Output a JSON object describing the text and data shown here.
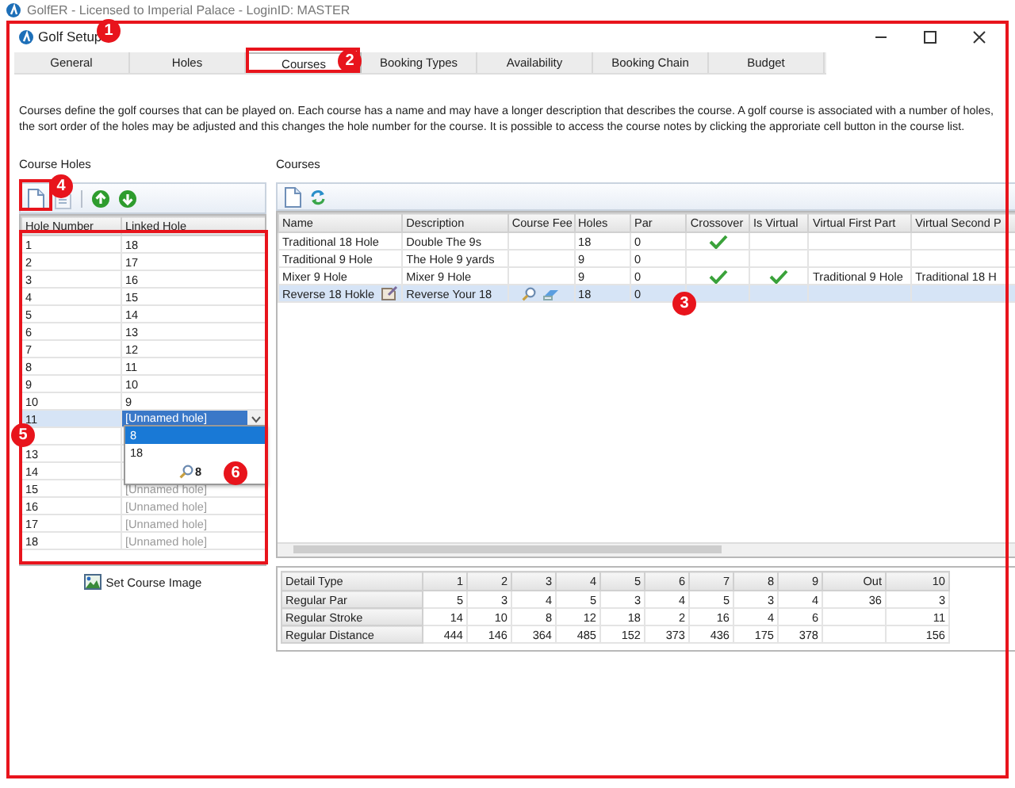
{
  "app_window": {
    "title": "GolfER - Licensed to Imperial Palace - LoginID: MASTER"
  },
  "dialog": {
    "title": "Golf Setup"
  },
  "tabs": [
    {
      "label": "General",
      "selected": false
    },
    {
      "label": "Holes",
      "selected": false
    },
    {
      "label": "Courses",
      "selected": true
    },
    {
      "label": "Booking Types",
      "selected": false
    },
    {
      "label": "Availability",
      "selected": false
    },
    {
      "label": "Booking Chain",
      "selected": false
    },
    {
      "label": "Budget",
      "selected": false
    }
  ],
  "description": "Courses define the golf courses that can be played on. Each course has a name and may have a longer description that describes the course. A golf course is associated with a number of holes, the sort order of the holes may be adjusted and this changes the hole number for the course. It is possible to access the course notes by clicking the approriate cell button in the course list.",
  "course_holes": {
    "title": "Course Holes",
    "columns": [
      "Hole Number",
      "Linked Hole"
    ],
    "rows": [
      {
        "hole": "1",
        "linked": "18",
        "kind": "linked",
        "selected": false
      },
      {
        "hole": "2",
        "linked": "17",
        "kind": "linked",
        "selected": false
      },
      {
        "hole": "3",
        "linked": "16",
        "kind": "linked",
        "selected": false
      },
      {
        "hole": "4",
        "linked": "15",
        "kind": "linked",
        "selected": false
      },
      {
        "hole": "5",
        "linked": "14",
        "kind": "linked",
        "selected": false
      },
      {
        "hole": "6",
        "linked": "13",
        "kind": "linked",
        "selected": false
      },
      {
        "hole": "7",
        "linked": "12",
        "kind": "linked",
        "selected": false
      },
      {
        "hole": "8",
        "linked": "11",
        "kind": "linked",
        "selected": false
      },
      {
        "hole": "9",
        "linked": "10",
        "kind": "linked",
        "selected": false
      },
      {
        "hole": "10",
        "linked": "9",
        "kind": "linked",
        "selected": false
      },
      {
        "hole": "11",
        "linked": "[Unnamed hole]",
        "kind": "editing",
        "selected": true
      },
      {
        "kind": "linked",
        "selected": false
      },
      {
        "hole": "13",
        "kind": "linked",
        "selected": false
      },
      {
        "hole": "14",
        "kind": "linked",
        "selected": false
      },
      {
        "hole": "15",
        "linked": "[Unnamed hole]",
        "kind": "unassigned",
        "selected": false
      },
      {
        "hole": "16",
        "linked": "[Unnamed hole]",
        "kind": "unassigned",
        "selected": false
      },
      {
        "hole": "17",
        "linked": "[Unnamed hole]",
        "kind": "unassigned",
        "selected": false
      },
      {
        "hole": "18",
        "linked": "[Unnamed hole]",
        "kind": "unassigned",
        "selected": false
      }
    ],
    "dropdown": {
      "options": [
        {
          "label": "8",
          "selected": true
        },
        {
          "label": "18",
          "selected": false
        }
      ],
      "search": "8"
    },
    "set_image_label": "Set Course Image"
  },
  "courses": {
    "title": "Courses",
    "columns": [
      "Name",
      "Description",
      "Course Fee",
      "Holes",
      "Par",
      "Crossover",
      "Is Virtual",
      "Virtual First Part",
      "Virtual Second P"
    ],
    "rows": [
      {
        "name": "Traditional 18 Hole",
        "description": "Double The 9s",
        "holes": "18",
        "par": "0",
        "crossover": true,
        "is_virtual": false,
        "selected": false
      },
      {
        "name": "Traditional 9 Hole",
        "description": "The Hole 9 yards",
        "holes": "9",
        "par": "0",
        "crossover": false,
        "is_virtual": false,
        "selected": false
      },
      {
        "name": "Mixer 9 Hole",
        "description": "Mixer 9 Hole",
        "holes": "9",
        "par": "0",
        "crossover": true,
        "is_virtual": true,
        "virtual_first": "Traditional 9 Hole",
        "virtual_second": "Traditional 18 H",
        "selected": false
      },
      {
        "name": "Reverse 18 Hokle",
        "description": "Reverse Your 18",
        "holes": "18",
        "par": "0",
        "crossover": false,
        "is_virtual": false,
        "selected": true
      }
    ]
  },
  "details": {
    "columns": [
      "Detail Type",
      "1",
      "2",
      "3",
      "4",
      "5",
      "6",
      "7",
      "8",
      "9",
      "Out",
      "10"
    ],
    "rows": [
      {
        "type": "Regular Par",
        "front": [
          "5",
          "3",
          "4",
          "5",
          "3",
          "4",
          "5",
          "3",
          "4"
        ],
        "out": "36",
        "back": [
          "3"
        ]
      },
      {
        "type": "Regular Stroke",
        "front": [
          "14",
          "10",
          "8",
          "12",
          "18",
          "2",
          "16",
          "4",
          "6"
        ],
        "back": [
          "11"
        ]
      },
      {
        "type": "Regular Distance",
        "front": [
          "444",
          "146",
          "364",
          "485",
          "152",
          "373",
          "436",
          "175",
          "378"
        ],
        "back": [
          "156"
        ]
      }
    ]
  },
  "callouts": [
    {
      "number": "1"
    },
    {
      "number": "2"
    },
    {
      "number": "3"
    },
    {
      "number": "4"
    },
    {
      "number": "5"
    },
    {
      "number": "6"
    }
  ]
}
